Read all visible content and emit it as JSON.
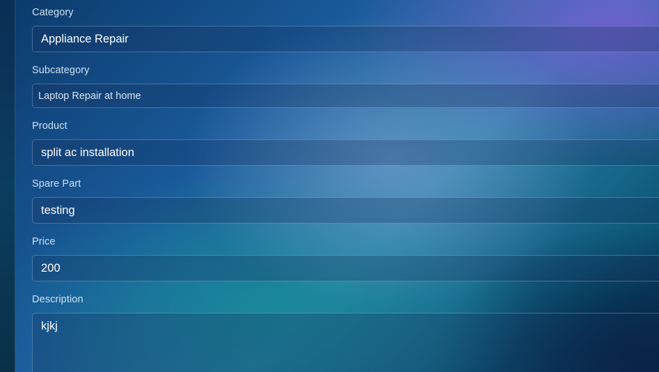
{
  "form": {
    "category": {
      "label": "Category",
      "value": "Appliance Repair"
    },
    "subcategory": {
      "label": "Subcategory",
      "value": "Laptop Repair at home"
    },
    "product": {
      "label": "Product",
      "value": "split ac installation"
    },
    "spare_part": {
      "label": "Spare Part",
      "value": "testing"
    },
    "price": {
      "label": "Price",
      "value": "200"
    },
    "description": {
      "label": "Description",
      "value": "kjkj"
    }
  }
}
